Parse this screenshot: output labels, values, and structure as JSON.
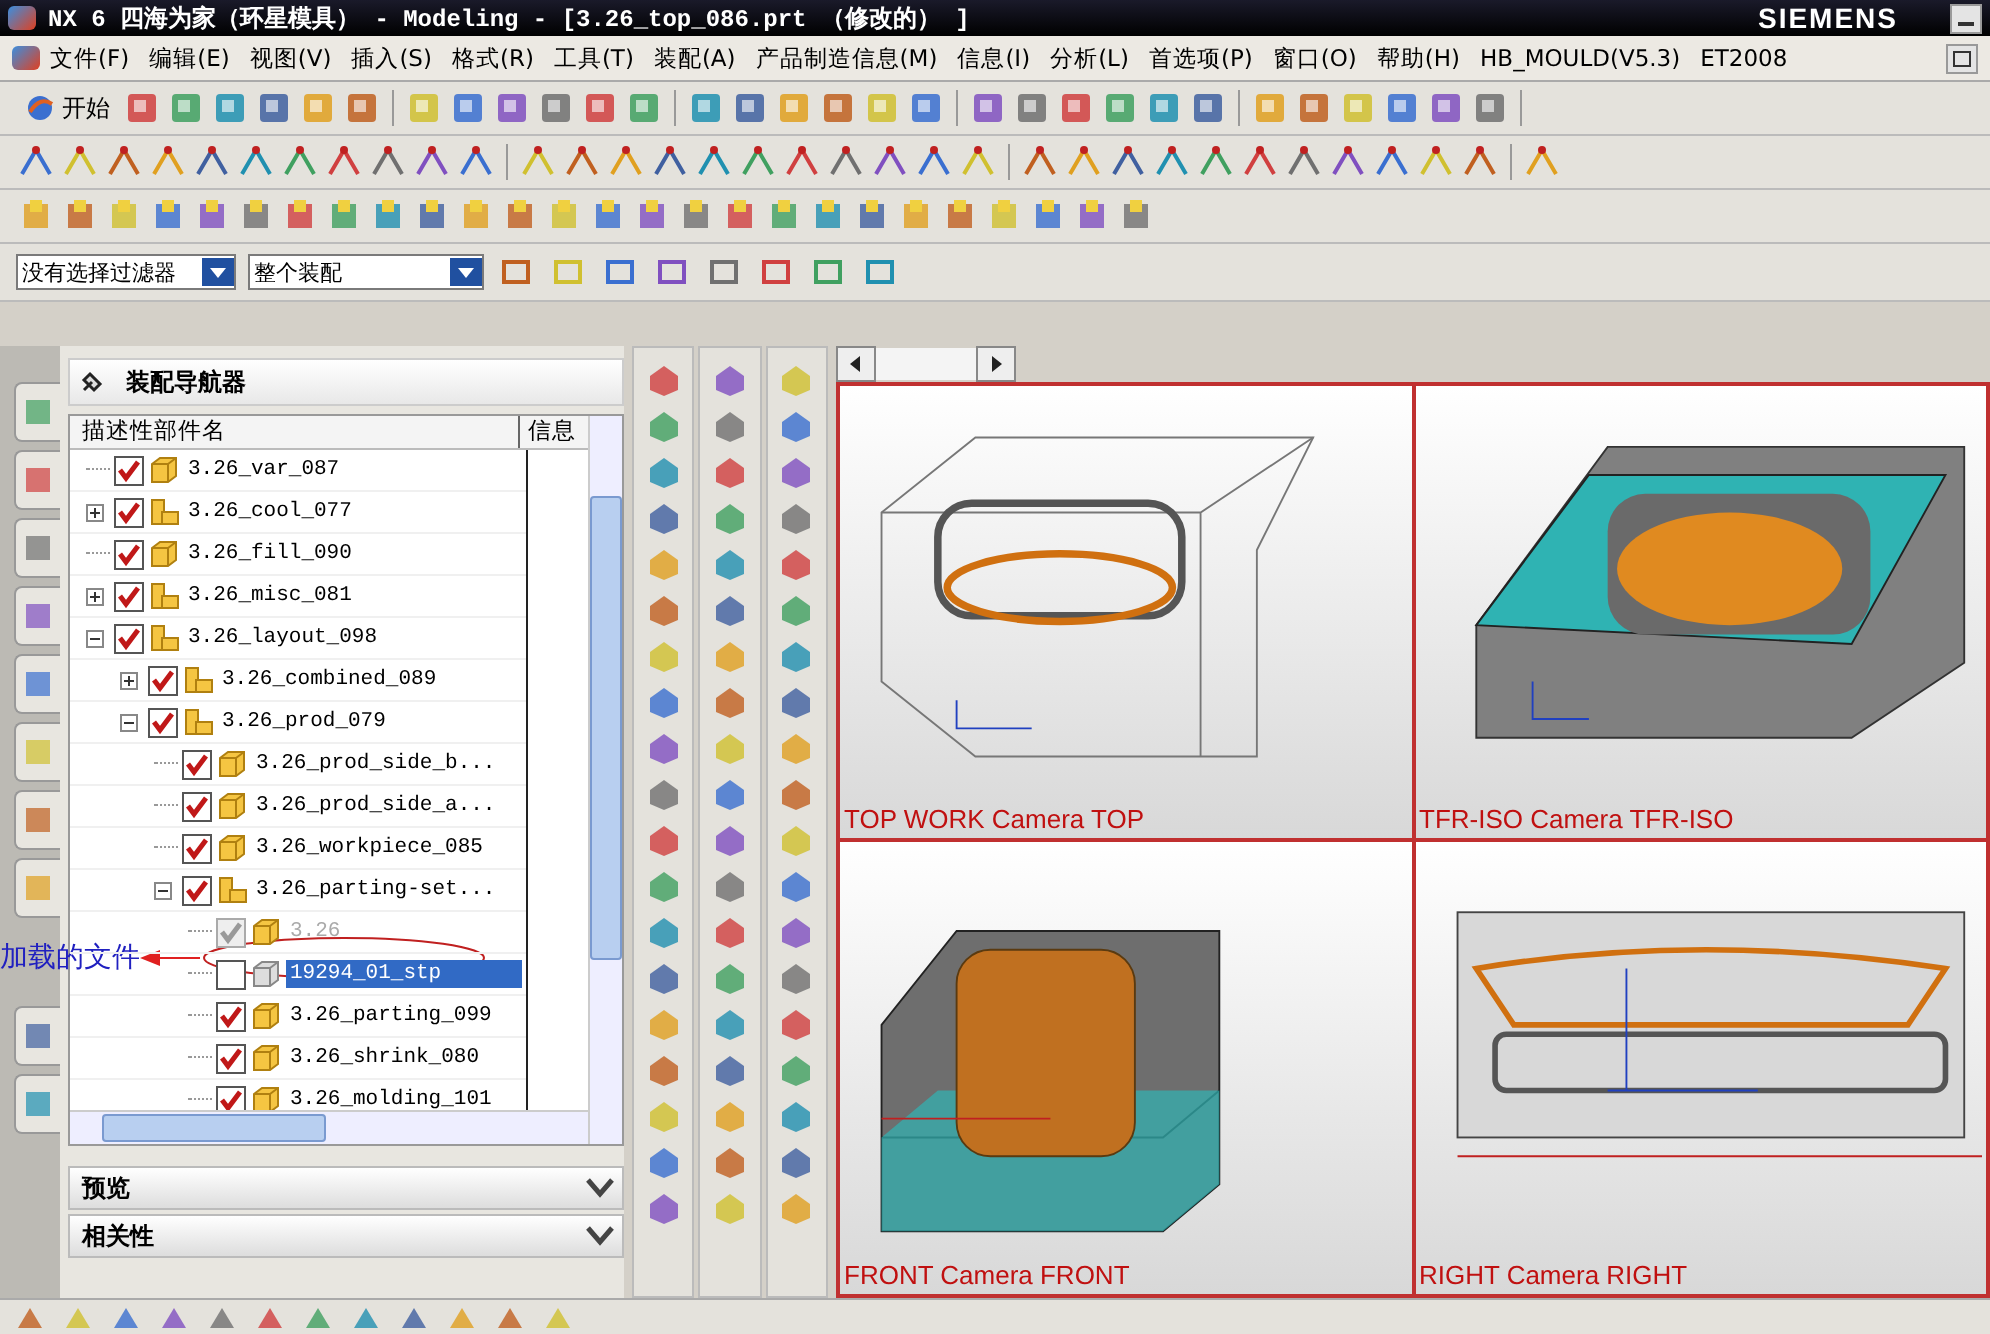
{
  "window": {
    "title": "NX 6 四海为家（环星模具） - Modeling - [3.26_top_086.prt （修改的） ]",
    "brand": "SIEMENS"
  },
  "menu": [
    "文件(F)",
    "编辑(E)",
    "视图(V)",
    "插入(S)",
    "格式(R)",
    "工具(T)",
    "装配(A)",
    "产品制造信息(M)",
    "信息(I)",
    "分析(L)",
    "首选项(P)",
    "窗口(O)",
    "帮助(H)",
    "HB_MOULD(V5.3)",
    "ET2008"
  ],
  "start_button": {
    "label": "开始"
  },
  "filters": [
    {
      "value": "没有选择过滤器"
    },
    {
      "value": "整个装配"
    }
  ],
  "navigator": {
    "title": "装配导航器",
    "columns": [
      "描述性部件名",
      "信息"
    ],
    "tree": [
      {
        "name": "3.26_var_087",
        "kind": "part",
        "checked": true,
        "disabled": false,
        "selected": false
      },
      {
        "name": "3.26_cool_077",
        "kind": "assembly",
        "checked": true,
        "disabled": false,
        "selected": false,
        "expanded": false
      },
      {
        "name": "3.26_fill_090",
        "kind": "part",
        "checked": true,
        "disabled": false,
        "selected": false
      },
      {
        "name": "3.26_misc_081",
        "kind": "assembly",
        "checked": true,
        "disabled": false,
        "selected": false,
        "expanded": false
      },
      {
        "name": "3.26_layout_098",
        "kind": "assembly",
        "checked": true,
        "disabled": false,
        "selected": false,
        "expanded": true,
        "children": [
          {
            "name": "3.26_combined_089",
            "kind": "assembly",
            "checked": true,
            "disabled": false,
            "selected": false,
            "expanded": false
          },
          {
            "name": "3.26_prod_079",
            "kind": "assembly",
            "checked": true,
            "disabled": false,
            "selected": false,
            "expanded": true,
            "children": [
              {
                "name": "3.26_prod_side_b...",
                "kind": "part",
                "checked": true,
                "disabled": false,
                "selected": false
              },
              {
                "name": "3.26_prod_side_a...",
                "kind": "part",
                "checked": true,
                "disabled": false,
                "selected": false
              },
              {
                "name": "3.26_workpiece_085",
                "kind": "part",
                "checked": true,
                "disabled": false,
                "selected": false
              },
              {
                "name": "3.26_parting-set...",
                "kind": "assembly",
                "checked": true,
                "disabled": false,
                "selected": false,
                "expanded": true,
                "children": [
                  {
                    "name": "3.26",
                    "kind": "part",
                    "checked": true,
                    "disabled": true,
                    "selected": false
                  },
                  {
                    "name": "19294_01_stp",
                    "kind": "unloaded",
                    "checked": false,
                    "disabled": false,
                    "selected": true
                  },
                  {
                    "name": "3.26_parting_099",
                    "kind": "part",
                    "checked": true,
                    "disabled": false,
                    "selected": false
                  },
                  {
                    "name": "3.26_shrink_080",
                    "kind": "part",
                    "checked": true,
                    "disabled": false,
                    "selected": false
                  },
                  {
                    "name": "3.26_molding_101",
                    "kind": "part",
                    "checked": true,
                    "disabled": false,
                    "selected": false
                  }
                ]
              }
            ]
          }
        ]
      }
    ],
    "panels": [
      {
        "label": "预览"
      },
      {
        "label": "相关性"
      }
    ]
  },
  "annotation": {
    "text": "加载的文件"
  },
  "views": [
    {
      "label": "TOP WORK Camera TOP",
      "kind": "top"
    },
    {
      "label": "TFR-ISO Camera TFR-ISO",
      "kind": "iso"
    },
    {
      "label": "FRONT Camera FRONT",
      "kind": "front"
    },
    {
      "label": "RIGHT Camera RIGHT",
      "kind": "right"
    }
  ]
}
